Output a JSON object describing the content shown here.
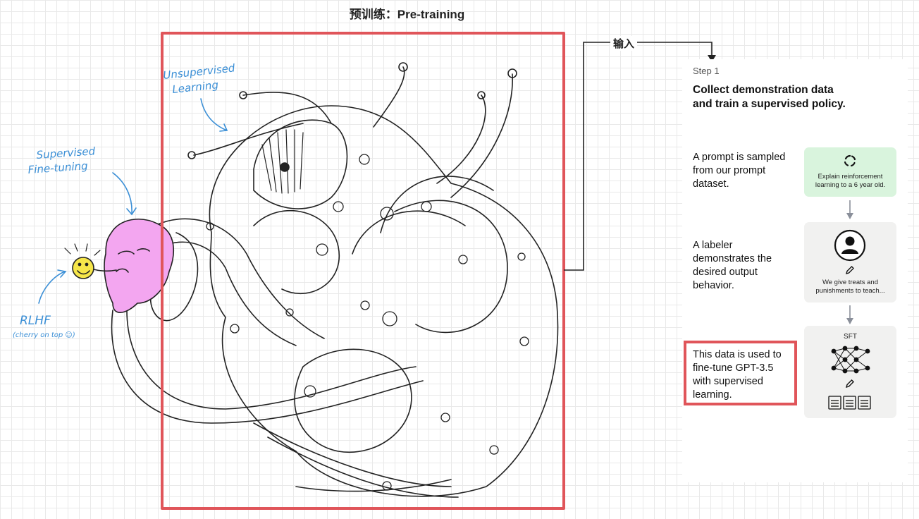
{
  "title": "预训练：Pre-training",
  "connector": {
    "label": "输入"
  },
  "illustration": {
    "labels": {
      "unsupervised": "Unsupervised Learning",
      "supervised": "Supervised Fine-tuning",
      "rlhf": "RLHF",
      "rlhf_note": "(cherry on top ☺)"
    }
  },
  "panel": {
    "step_label": "Step 1",
    "title_line1": "Collect demonstration data",
    "title_line2": "and train a supervised policy.",
    "steps": [
      {
        "text": "A prompt is sampled from our prompt dataset.",
        "card_text": "Explain reinforcement learning to a 6 year old.",
        "icon": "refresh-icon"
      },
      {
        "text": "A labeler demonstrates the desired output behavior.",
        "card_text": "We give treats and punishments to teach...",
        "icon": "user-icon"
      },
      {
        "text": "This data is used to fine-tune GPT-3.5 with supervised learning.",
        "card_label": "SFT",
        "icon": "neural-network-icon"
      }
    ]
  },
  "colors": {
    "highlight_red": "#e0555a",
    "prompt_green": "#d9f4dd",
    "card_gray": "#f1f1f0",
    "pink_face": "#f3a6f0",
    "smiley_yellow": "#f6e64a",
    "annotation_blue": "#3b8fd6"
  }
}
